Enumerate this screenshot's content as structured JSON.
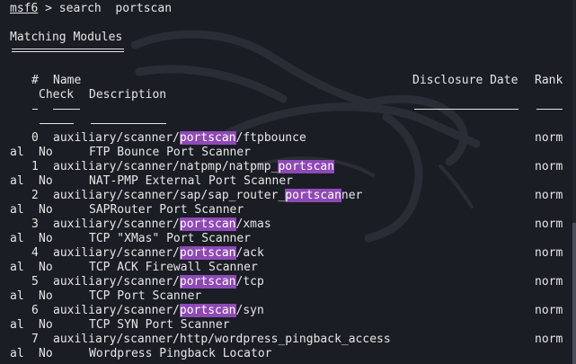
{
  "prompt": {
    "name": "msf6",
    "rest": " > search  portscan"
  },
  "heading": "Matching Modules",
  "columns": {
    "num": "#",
    "name": "Name",
    "disclosure_date": "Disclosure Date",
    "rank": "Rank",
    "check": "Check",
    "description": "Description"
  },
  "rows": [
    {
      "num": "0",
      "pre": "auxiliary/scanner/",
      "match": "portscan",
      "post": "/ftpbounce",
      "rank_a": "norm",
      "rank_b": "al",
      "check": "No",
      "desc": "FTP Bounce Port Scanner"
    },
    {
      "num": "1",
      "pre": "auxiliary/scanner/natpmp/natpmp_",
      "match": "portscan",
      "post": "",
      "rank_a": "norm",
      "rank_b": "al",
      "check": "No",
      "desc": "NAT-PMP External Port Scanner"
    },
    {
      "num": "2",
      "pre": "auxiliary/scanner/sap/sap_router_",
      "match": "portscan",
      "post": "ner",
      "rank_a": "norm",
      "rank_b": "al",
      "check": "No",
      "desc": "SAPRouter Port Scanner"
    },
    {
      "num": "3",
      "pre": "auxiliary/scanner/",
      "match": "portscan",
      "post": "/xmas",
      "rank_a": "norm",
      "rank_b": "al",
      "check": "No",
      "desc": "TCP \"XMas\" Port Scanner"
    },
    {
      "num": "4",
      "pre": "auxiliary/scanner/",
      "match": "portscan",
      "post": "/ack",
      "rank_a": "norm",
      "rank_b": "al",
      "check": "No",
      "desc": "TCP ACK Firewall Scanner"
    },
    {
      "num": "5",
      "pre": "auxiliary/scanner/",
      "match": "portscan",
      "post": "/tcp",
      "rank_a": "norm",
      "rank_b": "al",
      "check": "No",
      "desc": "TCP Port Scanner"
    },
    {
      "num": "6",
      "pre": "auxiliary/scanner/",
      "match": "portscan",
      "post": "/syn",
      "rank_a": "norm",
      "rank_b": "al",
      "check": "No",
      "desc": "TCP SYN Port Scanner"
    },
    {
      "num": "7",
      "pre": "auxiliary/scanner/http/wordpress_pingback_access",
      "match": "",
      "post": "",
      "rank_a": "norm",
      "rank_b": "al",
      "check": "No",
      "desc": "Wordpress Pingback Locator"
    }
  ],
  "colors": {
    "background": "#1b1d24",
    "text": "#e6e6e6",
    "highlight": "#8e49b5"
  },
  "icons": {
    "watermark": "kali-dragon-icon"
  }
}
